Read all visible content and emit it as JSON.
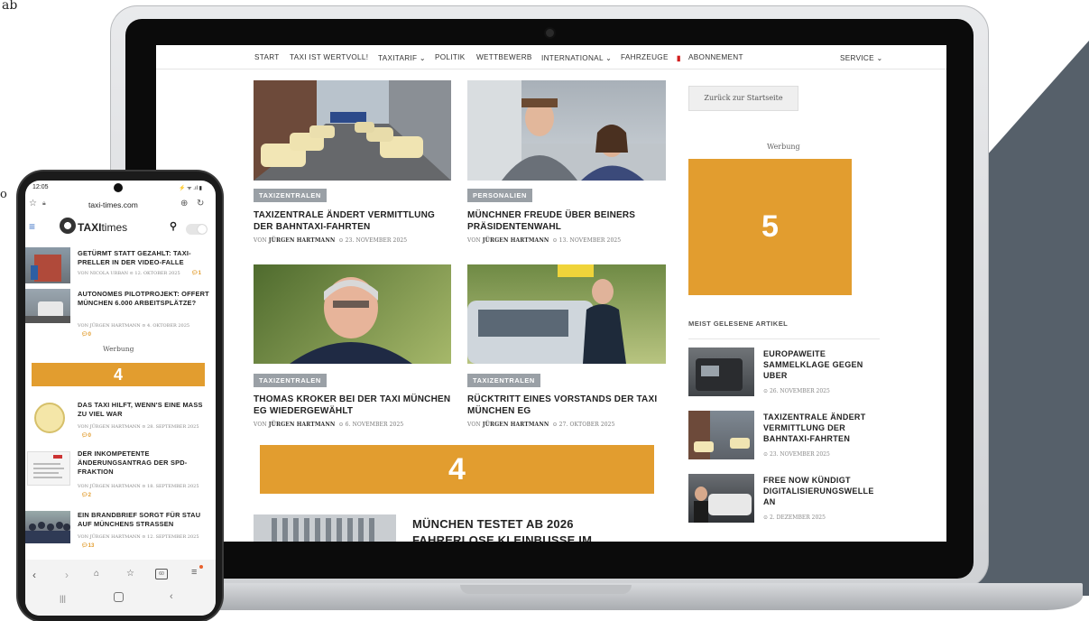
{
  "page": {
    "corner_text": "ab",
    "side_letter": "o"
  },
  "desktop": {
    "nav": [
      "START",
      "TAXI IST WERTVOLL!",
      "TAXITARIF ⌄",
      "POLITIK",
      "WETTBEWERB",
      "INTERNATIONAL ⌄",
      "FAHRZEUGE",
      "ABONNEMENT",
      "SERVICE ⌄"
    ],
    "articles": [
      {
        "tag": "TAXIZENTRALEN",
        "title": "TAXIZENTRALE ÄNDERT VERMITTLUNG DER BAHNTAXI-FAHRTEN",
        "author": "JÜRGEN HARTMANN",
        "date": "23. NOVEMBER 2025"
      },
      {
        "tag": "PERSONALIEN",
        "title": "MÜNCHNER FREUDE ÜBER BEINERS PRÄSIDENTENWAHL",
        "author": "JÜRGEN HARTMANN",
        "date": "13. NOVEMBER 2025"
      },
      {
        "tag": "TAXIZENTRALEN",
        "title": "THOMAS KROKER BEI DER TAXI MÜNCHEN EG WIEDERGEWÄHLT",
        "author": "JÜRGEN HARTMANN",
        "date": "6. NOVEMBER 2025"
      },
      {
        "tag": "TAXIZENTRALEN",
        "title": "RÜCKTRITT EINES VORSTANDS DER TAXI MÜNCHEN EG",
        "author": "JÜRGEN HARTMANN",
        "date": "27. OKTOBER 2025"
      }
    ],
    "meta_prefix": "VON",
    "ad_banner": "4",
    "bottom_article_title": "MÜNCHEN TESTET AB 2026 FAHRERLOSE KLEINBUSSE IM",
    "sidebar": {
      "back_button": "Zurück zur Startseite",
      "werbung": "Werbung",
      "ad_number": "5",
      "most_read_heading": "MEIST GELESENE ARTIKEL",
      "items": [
        {
          "title": "EUROPAWEITE SAMMELKLAGE GEGEN UBER",
          "date": "26. NOVEMBER 2025"
        },
        {
          "title": "TAXIZENTRALE ÄNDERT VERMITTLUNG DER BAHNTAXI-FAHRTEN",
          "date": "23. NOVEMBER 2025"
        },
        {
          "title": "FREE NOW KÜNDIGT DIGITALISIERUNGSWELLE AN",
          "date": "2. DEZEMBER 2025"
        }
      ]
    }
  },
  "mobile": {
    "time": "12:05",
    "status_icons": "⚡ ᯤ .ıl ▮",
    "url": "taxi-times.com",
    "logo_taxi": "TAXI",
    "logo_times": "times",
    "articles": [
      {
        "title": "GETÜRMT STATT GEZAHLT: TAXI-PRELLER IN DER VIDEO-FALLE",
        "author": "NICOLA URBAN",
        "date": "12. OKTOBER 2025",
        "comments": "1"
      },
      {
        "title": "AUTONOMES PILOTPROJEKT: OFFERT MÜNCHEN 6.000 ARBEITSPLÄTZE?",
        "author": "JÜRGEN HARTMANN",
        "date": "4. OKTOBER 2025",
        "comments": "0"
      },
      {
        "title": "DAS TAXI HILFT, WENN'S EINE MASS ZU VIEL WAR",
        "author": "JÜRGEN HARTMANN",
        "date": "28. SEPTEMBER 2025",
        "comments": "0"
      },
      {
        "title": "DER INKOMPETENTE ÄNDERUNGSANTRAG DER SPD-FRAKTION",
        "author": "JÜRGEN HARTMANN",
        "date": "18. SEPTEMBER 2025",
        "comments": "2"
      },
      {
        "title": "EIN BRANDBRIEF SORGT FÜR STAU AUF MÜNCHENS STRASSEN",
        "author": "JÜRGEN HARTMANN",
        "date": "12. SEPTEMBER 2025",
        "comments": "13"
      }
    ],
    "werbung": "Werbung",
    "ad_number": "4",
    "tab_count": "60"
  },
  "colors": {
    "accent": "#e29d2f",
    "slate": "#56606a",
    "tag_gray": "#9aa0a6",
    "nav_blue": "#3a6fc4"
  }
}
